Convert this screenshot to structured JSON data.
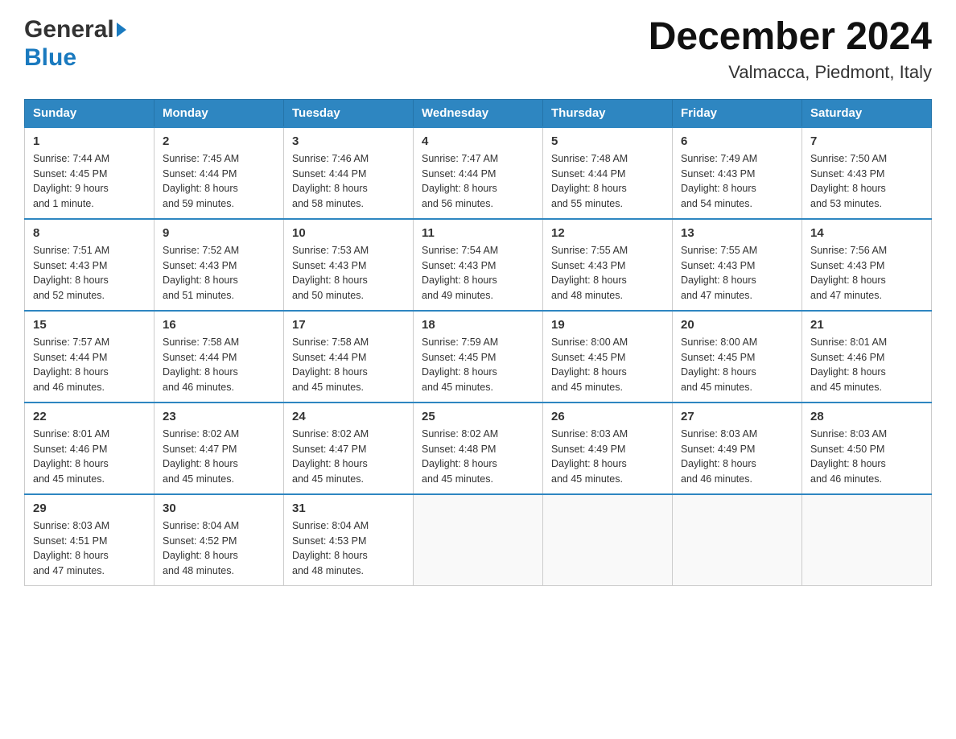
{
  "header": {
    "logo_general": "General",
    "logo_blue": "Blue",
    "title": "December 2024",
    "subtitle": "Valmacca, Piedmont, Italy"
  },
  "days_of_week": [
    "Sunday",
    "Monday",
    "Tuesday",
    "Wednesday",
    "Thursday",
    "Friday",
    "Saturday"
  ],
  "weeks": [
    [
      {
        "day": "1",
        "sunrise": "7:44 AM",
        "sunset": "4:45 PM",
        "daylight": "9 hours and 1 minute."
      },
      {
        "day": "2",
        "sunrise": "7:45 AM",
        "sunset": "4:44 PM",
        "daylight": "8 hours and 59 minutes."
      },
      {
        "day": "3",
        "sunrise": "7:46 AM",
        "sunset": "4:44 PM",
        "daylight": "8 hours and 58 minutes."
      },
      {
        "day": "4",
        "sunrise": "7:47 AM",
        "sunset": "4:44 PM",
        "daylight": "8 hours and 56 minutes."
      },
      {
        "day": "5",
        "sunrise": "7:48 AM",
        "sunset": "4:44 PM",
        "daylight": "8 hours and 55 minutes."
      },
      {
        "day": "6",
        "sunrise": "7:49 AM",
        "sunset": "4:43 PM",
        "daylight": "8 hours and 54 minutes."
      },
      {
        "day": "7",
        "sunrise": "7:50 AM",
        "sunset": "4:43 PM",
        "daylight": "8 hours and 53 minutes."
      }
    ],
    [
      {
        "day": "8",
        "sunrise": "7:51 AM",
        "sunset": "4:43 PM",
        "daylight": "8 hours and 52 minutes."
      },
      {
        "day": "9",
        "sunrise": "7:52 AM",
        "sunset": "4:43 PM",
        "daylight": "8 hours and 51 minutes."
      },
      {
        "day": "10",
        "sunrise": "7:53 AM",
        "sunset": "4:43 PM",
        "daylight": "8 hours and 50 minutes."
      },
      {
        "day": "11",
        "sunrise": "7:54 AM",
        "sunset": "4:43 PM",
        "daylight": "8 hours and 49 minutes."
      },
      {
        "day": "12",
        "sunrise": "7:55 AM",
        "sunset": "4:43 PM",
        "daylight": "8 hours and 48 minutes."
      },
      {
        "day": "13",
        "sunrise": "7:55 AM",
        "sunset": "4:43 PM",
        "daylight": "8 hours and 47 minutes."
      },
      {
        "day": "14",
        "sunrise": "7:56 AM",
        "sunset": "4:43 PM",
        "daylight": "8 hours and 47 minutes."
      }
    ],
    [
      {
        "day": "15",
        "sunrise": "7:57 AM",
        "sunset": "4:44 PM",
        "daylight": "8 hours and 46 minutes."
      },
      {
        "day": "16",
        "sunrise": "7:58 AM",
        "sunset": "4:44 PM",
        "daylight": "8 hours and 46 minutes."
      },
      {
        "day": "17",
        "sunrise": "7:58 AM",
        "sunset": "4:44 PM",
        "daylight": "8 hours and 45 minutes."
      },
      {
        "day": "18",
        "sunrise": "7:59 AM",
        "sunset": "4:45 PM",
        "daylight": "8 hours and 45 minutes."
      },
      {
        "day": "19",
        "sunrise": "8:00 AM",
        "sunset": "4:45 PM",
        "daylight": "8 hours and 45 minutes."
      },
      {
        "day": "20",
        "sunrise": "8:00 AM",
        "sunset": "4:45 PM",
        "daylight": "8 hours and 45 minutes."
      },
      {
        "day": "21",
        "sunrise": "8:01 AM",
        "sunset": "4:46 PM",
        "daylight": "8 hours and 45 minutes."
      }
    ],
    [
      {
        "day": "22",
        "sunrise": "8:01 AM",
        "sunset": "4:46 PM",
        "daylight": "8 hours and 45 minutes."
      },
      {
        "day": "23",
        "sunrise": "8:02 AM",
        "sunset": "4:47 PM",
        "daylight": "8 hours and 45 minutes."
      },
      {
        "day": "24",
        "sunrise": "8:02 AM",
        "sunset": "4:47 PM",
        "daylight": "8 hours and 45 minutes."
      },
      {
        "day": "25",
        "sunrise": "8:02 AM",
        "sunset": "4:48 PM",
        "daylight": "8 hours and 45 minutes."
      },
      {
        "day": "26",
        "sunrise": "8:03 AM",
        "sunset": "4:49 PM",
        "daylight": "8 hours and 45 minutes."
      },
      {
        "day": "27",
        "sunrise": "8:03 AM",
        "sunset": "4:49 PM",
        "daylight": "8 hours and 46 minutes."
      },
      {
        "day": "28",
        "sunrise": "8:03 AM",
        "sunset": "4:50 PM",
        "daylight": "8 hours and 46 minutes."
      }
    ],
    [
      {
        "day": "29",
        "sunrise": "8:03 AM",
        "sunset": "4:51 PM",
        "daylight": "8 hours and 47 minutes."
      },
      {
        "day": "30",
        "sunrise": "8:04 AM",
        "sunset": "4:52 PM",
        "daylight": "8 hours and 48 minutes."
      },
      {
        "day": "31",
        "sunrise": "8:04 AM",
        "sunset": "4:53 PM",
        "daylight": "8 hours and 48 minutes."
      },
      null,
      null,
      null,
      null
    ]
  ],
  "labels": {
    "sunrise": "Sunrise:",
    "sunset": "Sunset:",
    "daylight": "Daylight:"
  }
}
